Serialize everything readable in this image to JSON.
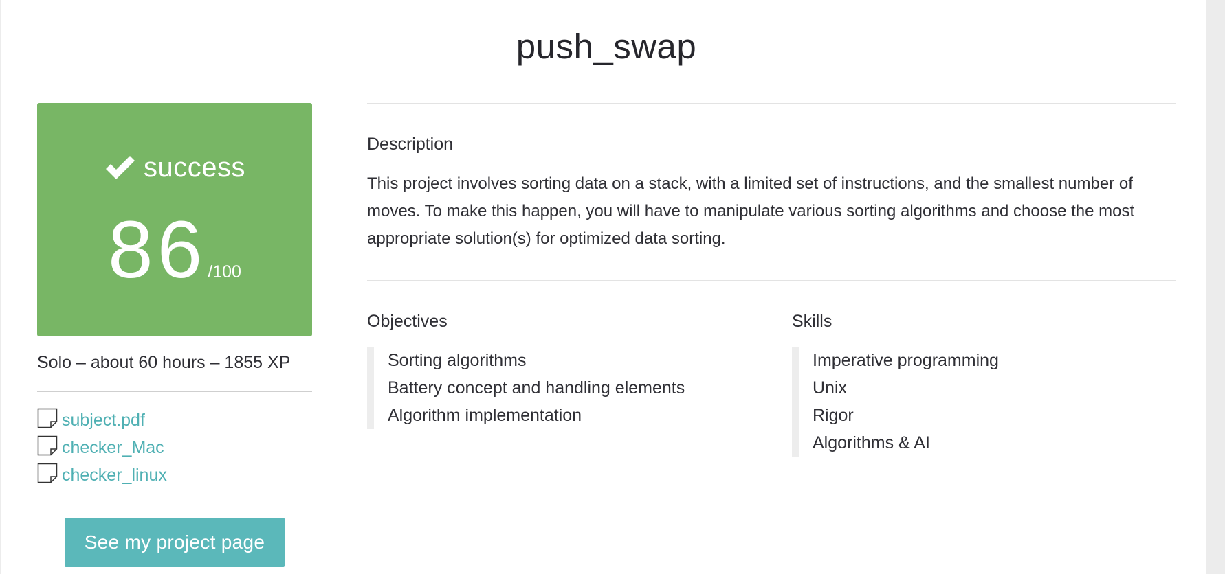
{
  "project": {
    "title": "push_swap"
  },
  "result": {
    "status": "success",
    "score": "86",
    "max_score": "/100",
    "color": "#78b665"
  },
  "meta": {
    "summary": "Solo – about 60 hours – 1855 XP"
  },
  "attachments": [
    {
      "name": "subject.pdf",
      "icon": "file-icon"
    },
    {
      "name": "checker_Mac",
      "icon": "file-icon"
    },
    {
      "name": "checker_linux",
      "icon": "file-icon"
    }
  ],
  "actions": {
    "project_page_label": "See my project page",
    "button_color": "#5bb8ba"
  },
  "description": {
    "heading": "Description",
    "text": "This project involves sorting data on a stack, with a limited set of instructions, and the smallest number of moves. To make this happen, you will have to manipulate various sorting algorithms and choose the most appropriate solution(s) for optimized data sorting."
  },
  "objectives": {
    "heading": "Objectives",
    "items": [
      "Sorting algorithms",
      "Battery concept and handling elements",
      "Algorithm implementation"
    ]
  },
  "skills": {
    "heading": "Skills",
    "items": [
      "Imperative programming",
      "Unix",
      "Rigor",
      "Algorithms & AI"
    ]
  }
}
